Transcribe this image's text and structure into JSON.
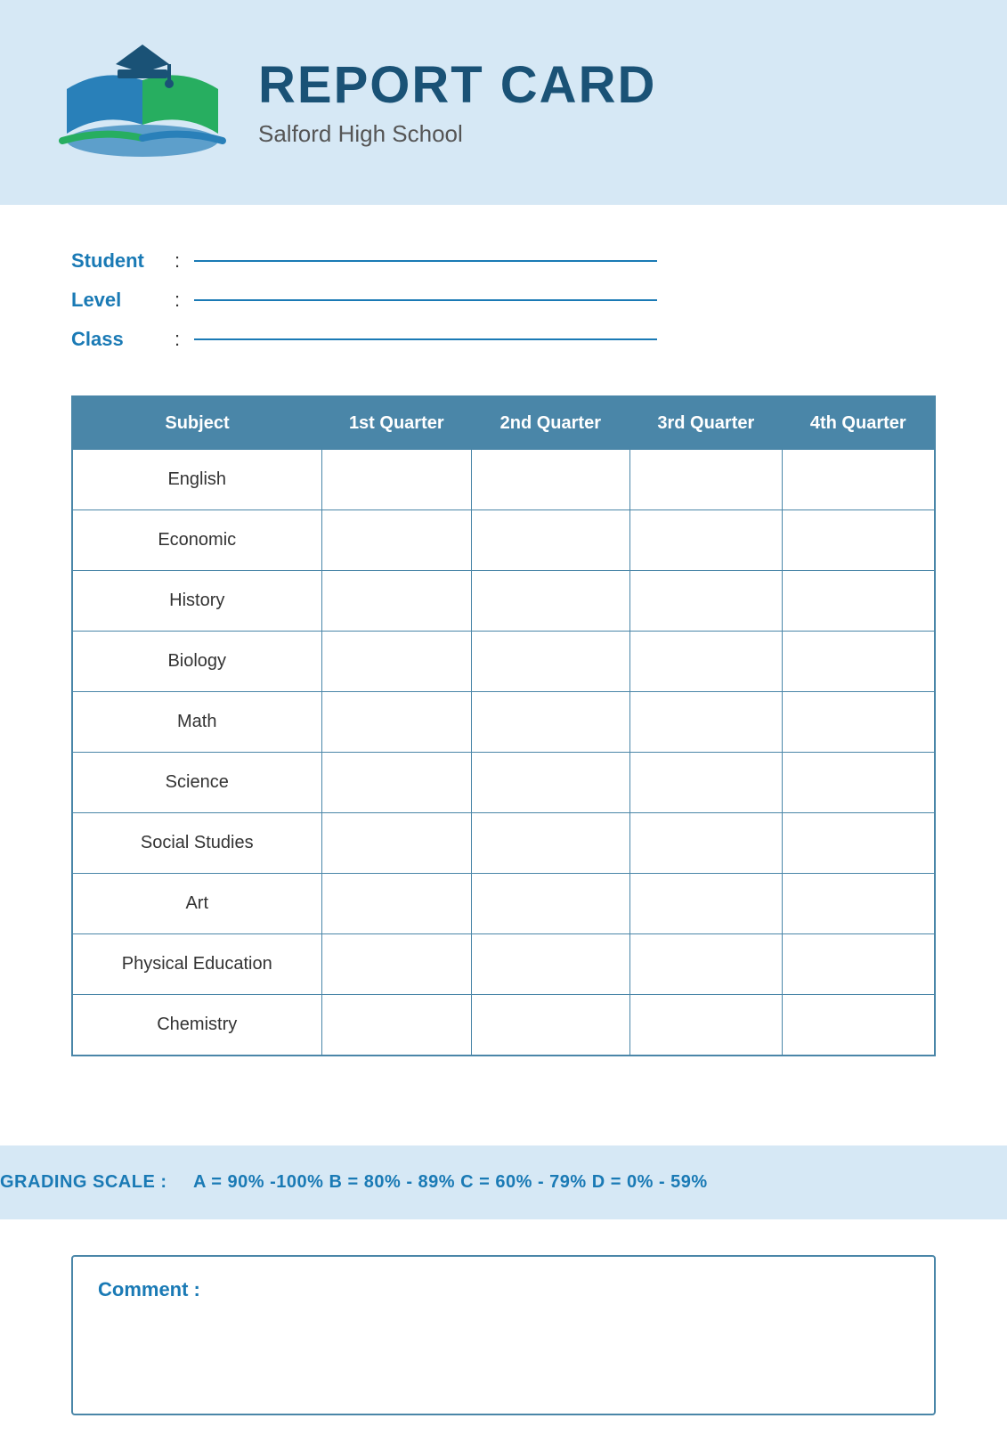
{
  "header": {
    "title": "REPORT CARD",
    "school": "Salford High School"
  },
  "student_info": {
    "student_label": "Student",
    "level_label": "Level",
    "class_label": "Class",
    "colon": ":"
  },
  "table": {
    "headers": [
      "Subject",
      "1st Quarter",
      "2nd Quarter",
      "3rd Quarter",
      "4th Quarter"
    ],
    "rows": [
      {
        "subject": "English"
      },
      {
        "subject": "Economic"
      },
      {
        "subject": "History"
      },
      {
        "subject": "Biology"
      },
      {
        "subject": "Math"
      },
      {
        "subject": "Science"
      },
      {
        "subject": "Social Studies"
      },
      {
        "subject": "Art"
      },
      {
        "subject": "Physical Education"
      },
      {
        "subject": "Chemistry"
      }
    ]
  },
  "grading_scale": {
    "label": "GRADING SCALE :",
    "values": "A = 90% -100%  B = 80% - 89%  C = 60% - 79%  D = 0% - 59%"
  },
  "comment": {
    "label": "Comment :"
  }
}
